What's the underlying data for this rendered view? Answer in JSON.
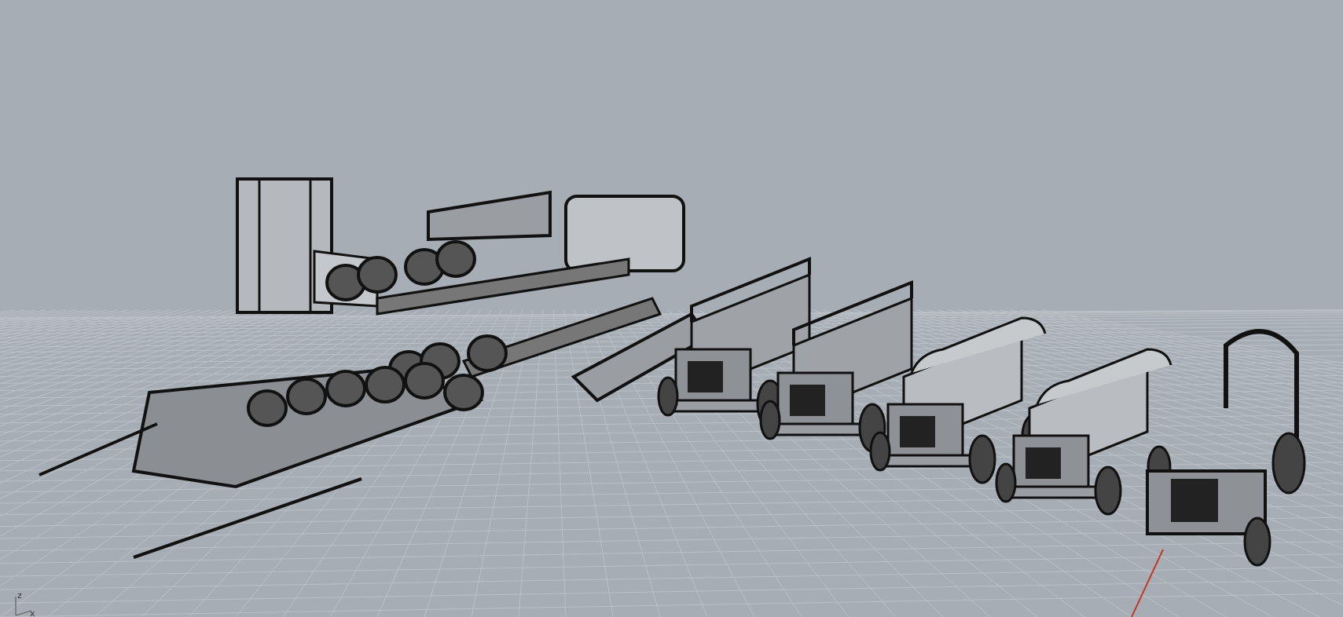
{
  "viewport": {
    "axis_labels": [
      "z",
      "x"
    ]
  }
}
